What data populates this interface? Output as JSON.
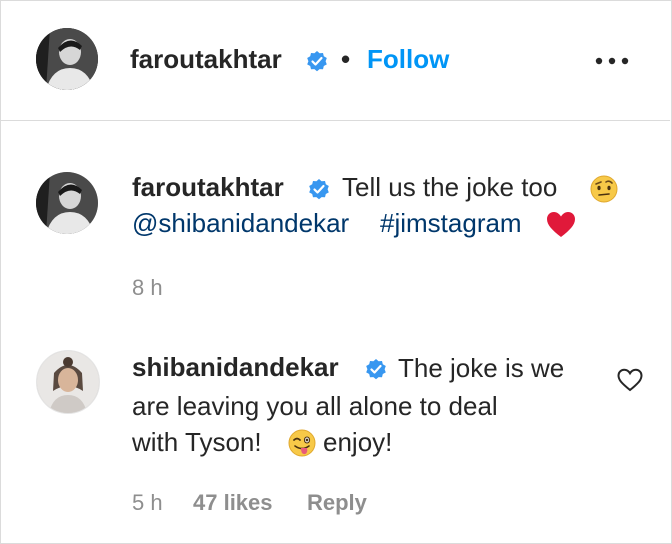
{
  "post_header": {
    "username": "faroutakhtar",
    "separator": "•",
    "follow_label": "Follow",
    "more_label": "more options"
  },
  "caption": {
    "username": "faroutakhtar",
    "text_line1": "Tell us the joke too",
    "mention": "@shibanidandekar",
    "hashtag": "#jimstagram",
    "time": "8 h"
  },
  "comment": {
    "username": "shibanidandekar",
    "text_line1": "The joke is we",
    "text_line2": "are leaving you all alone to deal",
    "text_line3_a": "with Tyson!",
    "text_line3_b": "enjoy!",
    "time": "5 h",
    "likes": "47 likes",
    "reply_label": "Reply"
  },
  "colors": {
    "follow": "#0095f6",
    "link": "#00376b",
    "verified": "#3897f0",
    "heart": "#ed4956",
    "meta": "#8e8e8e"
  },
  "icons": [
    "verified-badge-icon",
    "more-options-icon",
    "raised-eyebrow-emoji-icon",
    "red-heart-icon",
    "winking-tongue-emoji-icon",
    "like-heart-icon"
  ]
}
